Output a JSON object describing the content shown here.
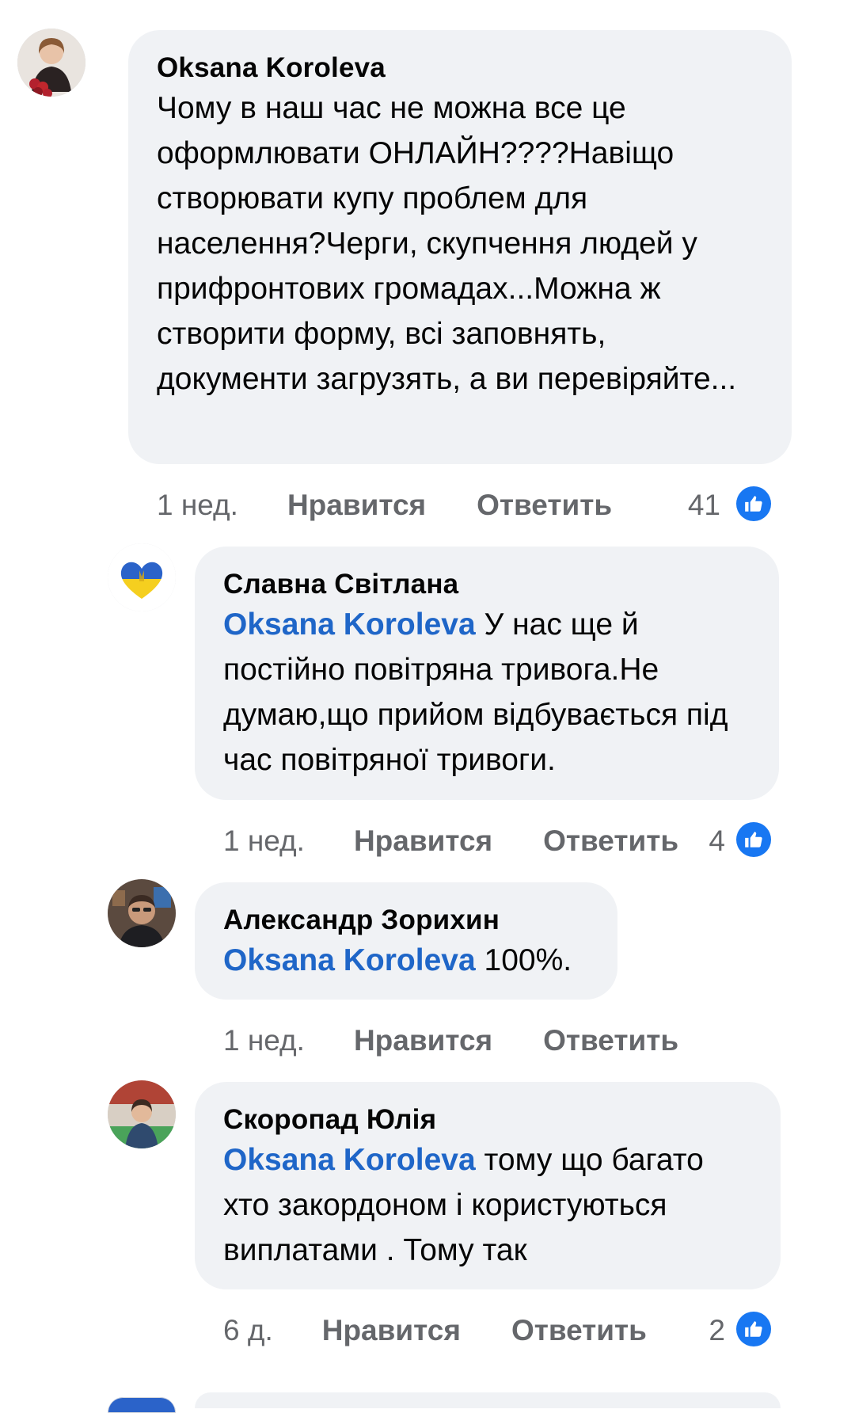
{
  "comments": [
    {
      "author": "Oksana Koroleva",
      "mention": "",
      "text": "Чому в наш час не можна все це оформлювати ОНЛАЙН????Навіщо створювати купу проблем для населення?Черги, скупчення людей у прифронтових громадах...Можна ж створити форму, всі заповнять, документи загрузять, а ви перевіряйте...",
      "time": "1 нед.",
      "like_label": "Нравится",
      "reply_label": "Ответить",
      "reactions": "41",
      "avatar": "woman-with-roses-avatar",
      "reaction_icon": "like-icon"
    },
    {
      "author": "Славна Світлана",
      "mention": "Oksana Koroleva",
      "text": "У нас ще й постійно повітряна тривога.Не думаю,що прийом відбувається під час повітряної тривоги.",
      "time": "1 нед.",
      "like_label": "Нравится",
      "reply_label": "Ответить",
      "reactions": "4",
      "avatar": "ukrainian-heart-avatar",
      "reaction_icon": "like-icon"
    },
    {
      "author": "Александр Зорихин",
      "mention": "Oksana Koroleva",
      "text": "100%.",
      "time": "1 нед.",
      "like_label": "Нравится",
      "reply_label": "Ответить",
      "reactions": "",
      "avatar": "man-avatar"
    },
    {
      "author": "Скоропад Юлія",
      "mention": "Oksana Koroleva",
      "text": "тому що багато хто закордоном і користуються виплатами . Тому так",
      "time": "6 д.",
      "like_label": "Нравится",
      "reply_label": "Ответить",
      "reactions": "2",
      "avatar": "woman-at-table-avatar",
      "reaction_icon": "like-icon"
    }
  ],
  "colors": {
    "bubble": "#f0f2f5",
    "mention": "#1f66c8",
    "meta": "#65676b",
    "like": "#1877f2"
  }
}
